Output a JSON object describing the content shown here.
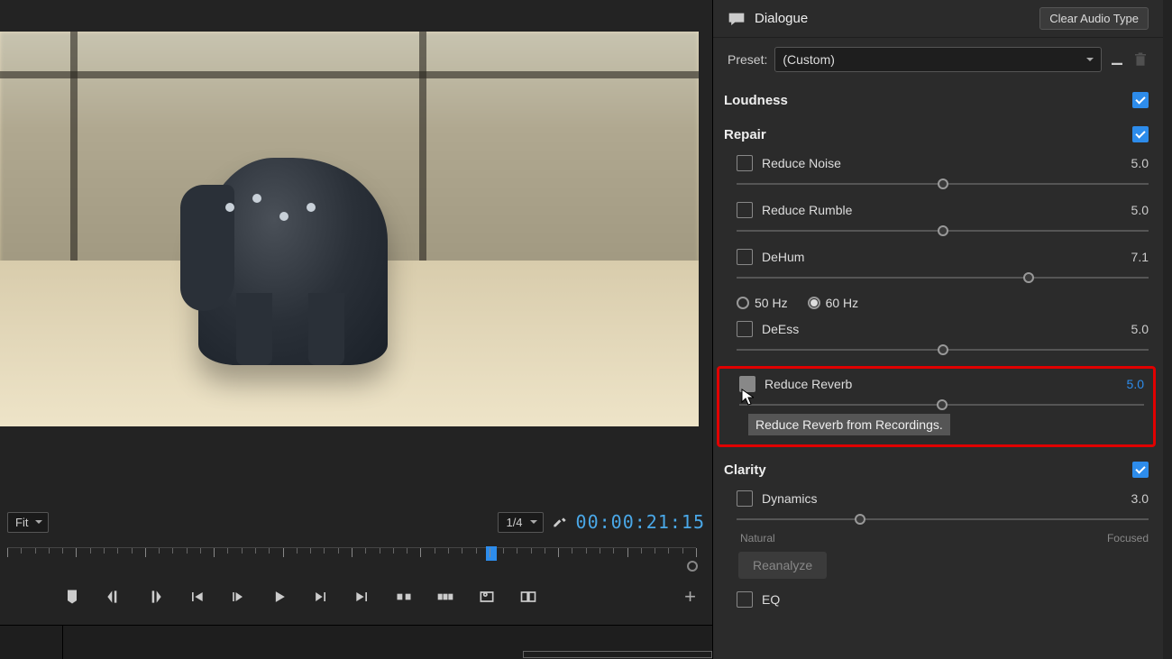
{
  "preview": {
    "zoom_label": "Fit",
    "scale_label": "1/4",
    "timecode": "00:00:21:15"
  },
  "panel": {
    "title": "Dialogue",
    "clear_button": "Clear Audio Type",
    "preset_label": "Preset:",
    "preset_value": "(Custom)",
    "sections": {
      "loudness": "Loudness",
      "repair": "Repair",
      "clarity": "Clarity"
    },
    "params": {
      "reduce_noise": {
        "label": "Reduce Noise",
        "value": "5.0",
        "pos": 50
      },
      "reduce_rumble": {
        "label": "Reduce Rumble",
        "value": "5.0",
        "pos": 50
      },
      "dehum": {
        "label": "DeHum",
        "value": "7.1",
        "pos": 71
      },
      "hz50": "50 Hz",
      "hz60": "60 Hz",
      "deess": {
        "label": "DeEss",
        "value": "5.0",
        "pos": 50
      },
      "reduce_reverb": {
        "label": "Reduce Reverb",
        "value": "5.0",
        "pos": 50,
        "tooltip": "Reduce Reverb from Recordings."
      },
      "dynamics": {
        "label": "Dynamics",
        "value": "3.0",
        "pos": 30,
        "left": "Natural",
        "right": "Focused"
      },
      "reanalyze": "Reanalyze",
      "eq": "EQ"
    }
  }
}
